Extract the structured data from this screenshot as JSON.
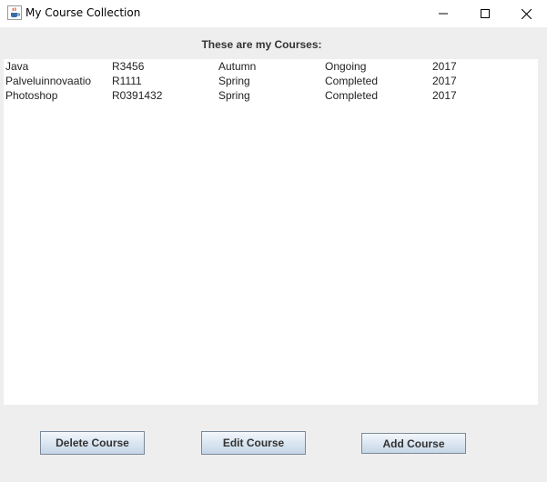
{
  "window": {
    "title": "My Course Collection"
  },
  "main": {
    "heading": "These are my Courses:",
    "courses": [
      [
        "Java",
        "R3456",
        "Autumn",
        "Ongoing",
        "2017"
      ],
      [
        "Palveluinnovaatio",
        "R1111",
        "Spring",
        "Completed",
        "2017"
      ],
      [
        "Photoshop",
        "R0391432",
        "Spring",
        "Completed",
        "2017"
      ]
    ]
  },
  "buttons": {
    "delete": "Delete Course",
    "edit": "Edit Course",
    "add": "Add Course"
  }
}
